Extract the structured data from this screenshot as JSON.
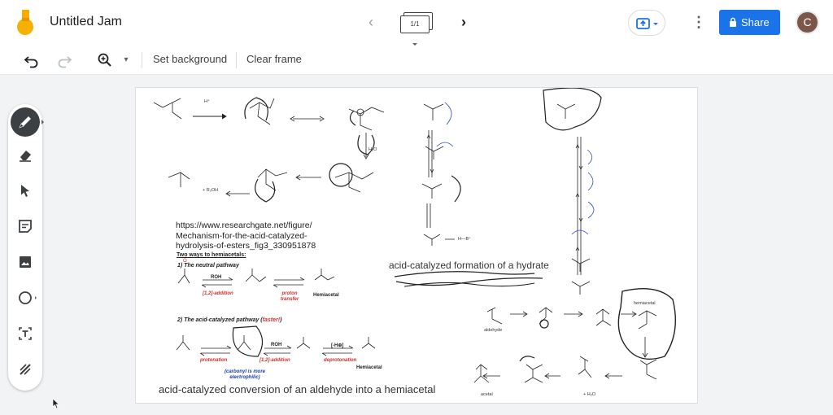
{
  "header": {
    "title": "Untitled Jam",
    "frame_counter": "1/1",
    "share_label": "Share",
    "avatar_initial": "C",
    "logo_colors": {
      "yellow": "#f9ab00",
      "orange": "#f6b100",
      "shadow": "#e37400"
    },
    "accent": "#1a73e8"
  },
  "toolbar": {
    "undo_icon": "undo-icon",
    "redo_icon": "redo-icon",
    "zoom_icon": "zoom-icon",
    "set_background_label": "Set background",
    "clear_frame_label": "Clear frame"
  },
  "side_tools": [
    {
      "name": "pen",
      "icon": "pen-icon",
      "active": true
    },
    {
      "name": "eraser",
      "icon": "eraser-icon"
    },
    {
      "name": "select",
      "icon": "cursor-icon"
    },
    {
      "name": "sticky-note",
      "icon": "sticky-note-icon"
    },
    {
      "name": "image",
      "icon": "image-icon"
    },
    {
      "name": "circle",
      "icon": "circle-icon"
    },
    {
      "name": "text-box",
      "icon": "text-box-icon"
    },
    {
      "name": "laser",
      "icon": "laser-icon"
    }
  ],
  "canvas": {
    "url_lines": [
      "https://www.researchgate.net/figure/",
      "Mechanism-for-the-acid-catalyzed-",
      "hydrolysis-of-esters_fig3_330951878"
    ],
    "hemiacetal_title": "Two ways to hemiacetals:",
    "neutral_pathway": "1) The neutral pathway",
    "acid_pathway_prefix": "2) The acid-catalyzed pathway (",
    "acid_pathway_fast": "faster!",
    "acid_pathway_suffix": ")",
    "addition_label": "[1,2]-addition",
    "addition_label_2": "[1,2]-addition",
    "proton_transfer_label": "proton transfer",
    "protonation_label": "protonation",
    "deprotonation_label": "deprotonation",
    "carbonyl_note": "(carbonyl is more electrophilic)",
    "hemiacetal_label_1": "Hemiacetal",
    "hemiacetal_label_2": "Hemiacetal",
    "roh_label_1": "ROH",
    "roh_label_2": "ROH",
    "minus_h_label": "[-H⊕]",
    "caption_hemiacetal": "acid-catalyzed conversion of an aldehyde into a hemiacetal",
    "caption_hydrate": "acid-catalyzed formation of a hydrate",
    "aldehyde_label": "aldehyde",
    "hemiacetal_small_label": "hemiacetal",
    "acetal_label": "acetal",
    "h2o_label": "+ H₂O",
    "h_plus_label": "H⁺",
    "h2o_mid_label": "H₂O",
    "r2oh_label": "+ R₂OH",
    "h_b_label": "H—B⁺"
  }
}
